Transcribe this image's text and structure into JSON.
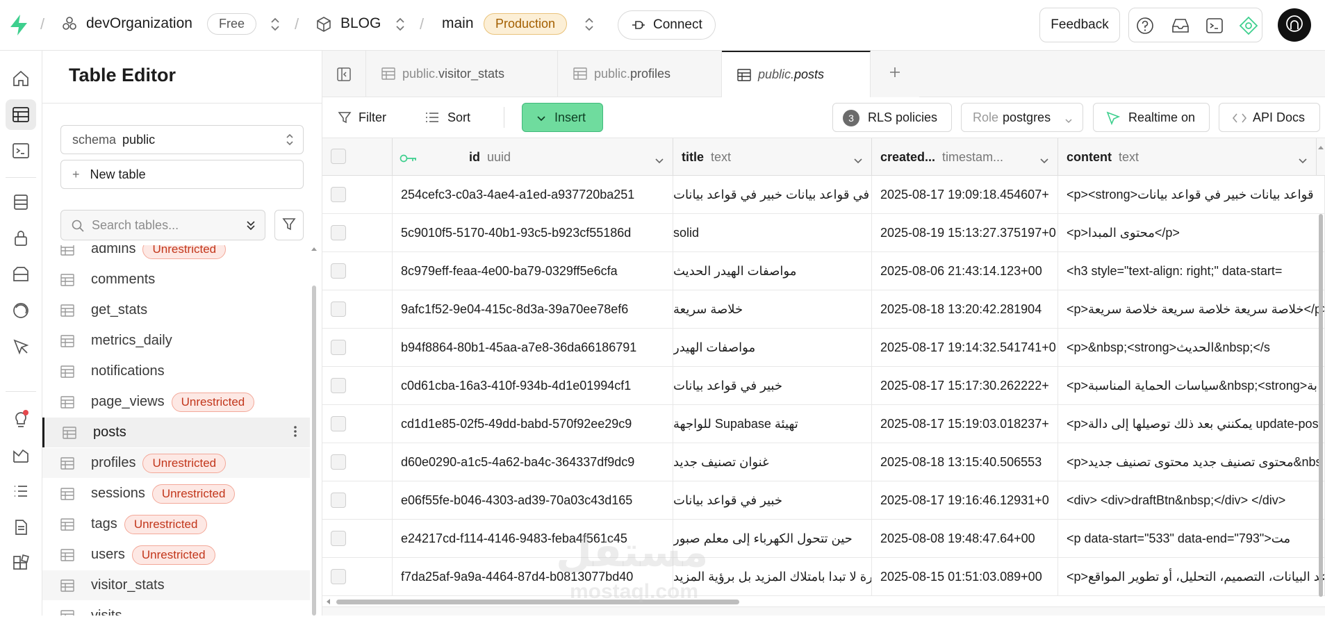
{
  "topbar": {
    "org_name": "devOrganization",
    "org_plan": "Free",
    "project_name": "BLOG",
    "branch_name": "main",
    "branch_env": "Production",
    "connect_label": "Connect",
    "feedback_label": "Feedback",
    "separator": "/"
  },
  "left_panel": {
    "title": "Table Editor",
    "schema_label": "schema",
    "schema_value": "public",
    "new_table_label": "New table",
    "search_placeholder": "Search tables...",
    "tables": [
      {
        "name": "admins",
        "badge": "Unrestricted"
      },
      {
        "name": "comments",
        "badge": ""
      },
      {
        "name": "get_stats",
        "badge": ""
      },
      {
        "name": "metrics_daily",
        "badge": ""
      },
      {
        "name": "notifications",
        "badge": ""
      },
      {
        "name": "page_views",
        "badge": "Unrestricted"
      },
      {
        "name": "posts",
        "badge": ""
      },
      {
        "name": "profiles",
        "badge": "Unrestricted"
      },
      {
        "name": "sessions",
        "badge": "Unrestricted"
      },
      {
        "name": "tags",
        "badge": "Unrestricted"
      },
      {
        "name": "users",
        "badge": "Unrestricted"
      },
      {
        "name": "visitor_stats",
        "badge": ""
      },
      {
        "name": "visits",
        "badge": ""
      }
    ]
  },
  "tabs": [
    {
      "schema": "public.",
      "name": "visitor_stats"
    },
    {
      "schema": "public.",
      "name": "profiles"
    },
    {
      "schema": "public.",
      "name": "posts"
    }
  ],
  "toolbar": {
    "filter_label": "Filter",
    "sort_label": "Sort",
    "insert_label": "Insert",
    "rls_count": "3",
    "rls_label": "RLS policies",
    "role_label": "Role",
    "role_value": "postgres",
    "realtime_label": "Realtime on",
    "api_docs_label": "API Docs"
  },
  "grid": {
    "columns": [
      {
        "name": "id",
        "type": "uuid"
      },
      {
        "name": "title",
        "type": "text"
      },
      {
        "name": "created...",
        "type": "timestam..."
      },
      {
        "name": "content",
        "type": "text"
      }
    ],
    "rows": [
      {
        "id": "254cefc3-c0a3-4ae4-a1ed-a937720ba251",
        "title": "خبير في قواعد بيانات خبير في قواعد بيانات",
        "created": "2025-08-17 19:09:18.454607+",
        "content": "<p><strong>قواعد بيانات خبير في قواعد بيانات"
      },
      {
        "id": "5c9010f5-5170-40b1-93c5-b923cf55186d",
        "title": "solid",
        "created": "2025-08-19 15:13:27.375197+0",
        "content": "<p>محتوى المبدا</p>"
      },
      {
        "id": "8c979eff-feaa-4e00-ba79-0329ff5e6cfa",
        "title": "مواصفات الهيدر الحديث",
        "created": "2025-08-06 21:43:14.123+00",
        "content": "<h3 style=\"text-align: right;\" data-start="
      },
      {
        "id": "9afc1f52-9e04-415c-8d3a-39a70ee78ef6",
        "title": "خلاصة سريعة",
        "created": "2025-08-18 13:20:42.281904",
        "content": "<p>خلاصة سريعة خلاصة سريعة خلاصة سريعة</p>"
      },
      {
        "id": "b94f8864-80b1-45aa-a7e8-36da66186791",
        "title": "مواصفات الهيدر",
        "created": "2025-08-17 19:14:32.541741+0",
        "content": "<p>&nbsp;<strong>الحديث&nbsp;</s"
      },
      {
        "id": "c0d61cba-16a3-410f-934b-4d1e01994cf1",
        "title": "خبير في قواعد بيانات",
        "created": "2025-08-17 15:17:30.262222+",
        "content": "<p>سياسات الحماية المناسبة&nbsp;<strong>بة"
      },
      {
        "id": "cd1d1e85-02f5-49dd-babd-570f92ee29c9",
        "title": "تهيئة Supabase للواجهة",
        "created": "2025-08-17 15:19:03.018237+",
        "content": "<p>يمكنني بعد ذلك توصيلها إلى دالة update-post"
      },
      {
        "id": "d60e0290-a1c5-4a62-ba4c-364337df9dc9",
        "title": "غنوان تصنيف جديد",
        "created": "2025-08-18 13:15:40.506553",
        "content": "<p>محتوى تصنيف جديد محتوى تصنيف جديد&nbs"
      },
      {
        "id": "e06f55fe-b046-4303-ad39-70a03c43d165",
        "title": "خبير في قواعد بيانات",
        "created": "2025-08-17 19:16:46.12931+0",
        "content": "<div> <div>draftBtn&nbsp;</div> </div>"
      },
      {
        "id": "e24217cd-f114-4146-9483-feba4f561c45",
        "title": "حين تتحول الكهرباء إلى معلم صبور",
        "created": "2025-08-08 19:48:47.64+00",
        "content": "<p data-start=\"533\" data-end=\"793\">مت"
      },
      {
        "id": "f7da25af-9a9a-4464-87d4-b0813077bd40",
        "title": "فرة لا تبدا بامتلاك المزيد بل برؤية المزيد",
        "created": "2025-08-15 01:51:03.089+00",
        "content": "<p>قواعد البيانات، التصميم، التحليل، أو تطوير المواقع"
      }
    ]
  },
  "watermark": {
    "text1": "مستقل",
    "text2": "mostaql.com"
  },
  "colors": {
    "accent": "#3ecf8e",
    "badge_red": "#c2361b",
    "prod_bg": "#fcefd6"
  }
}
